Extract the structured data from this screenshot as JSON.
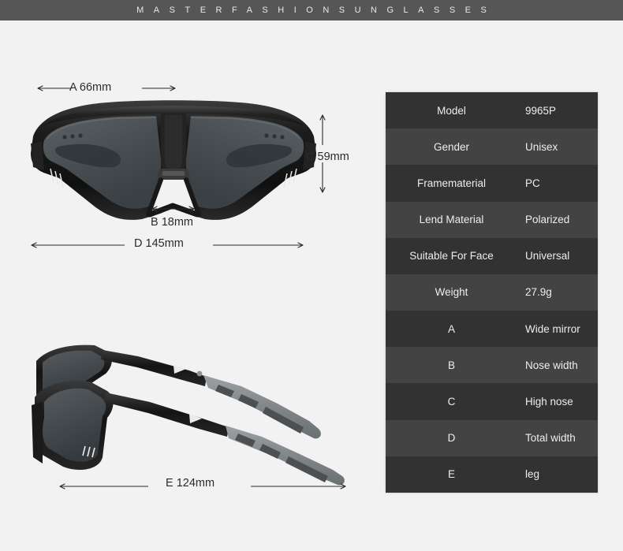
{
  "banner": {
    "text": "MASTERFASHIONSUNGLASSES"
  },
  "annotations": {
    "a": "A 66mm",
    "b": "B 18mm",
    "c": "C 59mm",
    "d": "D 145mm",
    "e": "E 124mm"
  },
  "images": {
    "front_view_alt": "sunglasses-front-view",
    "side_view_alt": "sunglasses-side-view"
  },
  "spec_table": {
    "rows": [
      {
        "key": "Model",
        "value": "9965P"
      },
      {
        "key": "Gender",
        "value": "Unisex"
      },
      {
        "key": "Framematerial",
        "value": "PC"
      },
      {
        "key": "Lend Material",
        "value": "Polarized"
      },
      {
        "key": "Suitable For Face",
        "value": "Universal"
      },
      {
        "key": "Weight",
        "value": "27.9g"
      },
      {
        "key": "A",
        "value": "Wide mirror"
      },
      {
        "key": "B",
        "value": "Nose width"
      },
      {
        "key": "C",
        "value": "High nose"
      },
      {
        "key": "D",
        "value": "Total width"
      },
      {
        "key": "E",
        "value": "leg"
      }
    ]
  },
  "colors": {
    "page_background": "#f2f2f2",
    "banner_background": "#565656",
    "table_row_odd": "#323232",
    "table_row_even": "#434343",
    "table_text": "#ededed",
    "annotation_text": "#2b2b2b",
    "frame_black": "#1b1b1b",
    "lens_gray": "#4a4f52",
    "temple_gray": "#8b8f92"
  }
}
